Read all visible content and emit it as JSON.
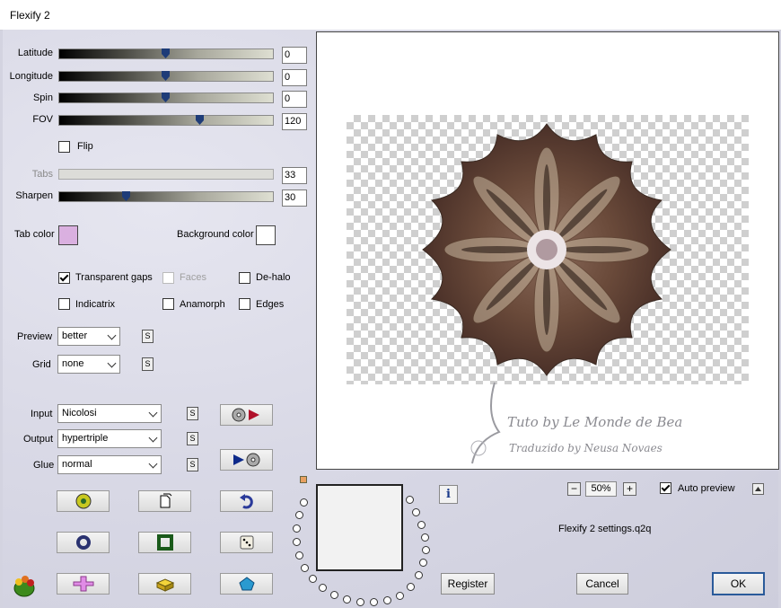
{
  "window": {
    "title": "Flexify 2"
  },
  "sliders": {
    "latitude": {
      "label": "Latitude",
      "value": "0",
      "position": 0.5
    },
    "longitude": {
      "label": "Longitude",
      "value": "0",
      "position": 0.5
    },
    "spin": {
      "label": "Spin",
      "value": "0",
      "position": 0.5
    },
    "fov": {
      "label": "FOV",
      "value": "120",
      "position": 0.66
    },
    "tabs": {
      "label": "Tabs",
      "value": "33",
      "position": 0.0
    },
    "sharpen": {
      "label": "Sharpen",
      "value": "30",
      "position": 0.31
    }
  },
  "flip": {
    "label": "Flip",
    "checked": false
  },
  "colors": {
    "tab_color_label": "Tab color",
    "tab_color": "#dab0e0",
    "background_color_label": "Background color",
    "background_color": "#ffffff"
  },
  "options": {
    "transparent_gaps": "Transparent gaps",
    "faces": "Faces",
    "de_halo": "De-halo",
    "indicatrix": "Indicatrix",
    "anamorph": "Anamorph",
    "edges": "Edges"
  },
  "selects": {
    "preview_label": "Preview",
    "preview_value": "better",
    "grid_label": "Grid",
    "grid_value": "none",
    "input_label": "Input",
    "input_value": "Nicolosi",
    "output_label": "Output",
    "output_value": "hypertriple",
    "glue_label": "Glue",
    "glue_value": "normal",
    "s_glyph": "S"
  },
  "zoom": {
    "minus": "−",
    "value": "50%",
    "plus": "+"
  },
  "auto_preview": {
    "label": "Auto preview",
    "checked": true
  },
  "settings_file": "Flexify 2 settings.q2q",
  "watermark": {
    "line1": "Tuto by Le Monde de Bea",
    "line2": "Traduzido by Neusa Novaes"
  },
  "info_glyph": "i",
  "buttons": {
    "register": "Register",
    "cancel": "Cancel",
    "ok": "OK"
  },
  "icons": [
    "random-gear-icon",
    "new-page-icon",
    "undo-icon",
    "ring-icon",
    "frame-icon",
    "dice-icon",
    "pink-cross-icon",
    "yellow-brick-icon",
    "pentagon-icon"
  ]
}
